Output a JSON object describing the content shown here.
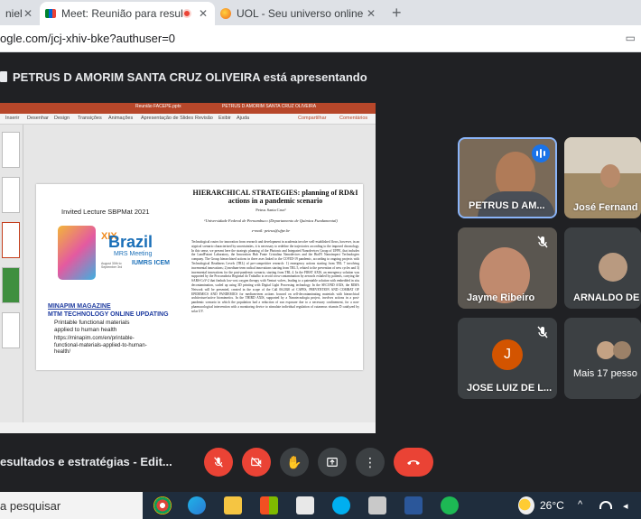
{
  "tabs": [
    {
      "title": "niel",
      "active": false
    },
    {
      "title": "Meet: Reunião para resultad",
      "active": true
    },
    {
      "title": "UOL - Seu universo online",
      "active": false
    }
  ],
  "address": {
    "url": "ogle.com/jcj-xhiv-bke?authuser=0"
  },
  "meet": {
    "presenter_banner": "PETRUS D AMORIM SANTA CRUZ OLIVEIRA está apresentando",
    "meeting_title": "esultados e estratégias - Edit...",
    "participants": [
      {
        "name": "PETRUS D AM...",
        "speaking": true
      },
      {
        "name": "José Fernand"
      },
      {
        "name": "Jayme Ribeiro",
        "muted": true
      },
      {
        "name": "ARNALDO DE"
      },
      {
        "name": "JOSE LUIZ DE L...",
        "initial": "J",
        "muted": true
      },
      {
        "name": "Mais 17 pesso"
      }
    ]
  },
  "ppt": {
    "file_name": "Reunião FACEPE.pptx",
    "file_name_right": "PETRUS D AMORIM SANTA CRUZ OLIVEIRA",
    "ribbon": [
      "Inserir",
      "Desenhar",
      "Design",
      "Transições",
      "Animações",
      "Apresentação de Slides",
      "Revisão",
      "Exibir",
      "Ajuda"
    ],
    "ribbon_right": [
      "Compartilhar",
      "Comentários"
    ]
  },
  "slide": {
    "invited": "Invited Lecture SBPMat 2021",
    "xix": "XIX",
    "brazil": "Brazil",
    "mrs": "MRS Meeting",
    "mrs_date": "August 30th to September 3rd",
    "iumrs": "IUMRS ICEM",
    "magazine_1": "MINAPIM MAGAZINE",
    "magazine_2": "MTM TECHNOLOGY ONLINE UPDATING",
    "printable": "Printable functional materials applied to human health",
    "link": "https://minapim.com/en/printable-functional-materials-applied-to-human-health/",
    "paper_title": "HIERARCHICAL STRATEGIES: planning of RD&I actions in a pandemic scenario",
    "author": "Petrus Santa Cruz¹",
    "affiliation": "¹Universidade Federal de Pernambuco (Departamento de Química Fundamental)",
    "email": "e-mail: petrus@ufpe.br",
    "abstract": "Technological routes for innovation from research and development in academia involve well-established flows, however, in an atypical scenario characterized by uncertainties, it is necessary to redefine the trajectories according to the imposed chronology. In this sense, we present here the strategic planning of the Photonic and Integrated Nanodevices Group of UFPE, that includes the LandFotoni Laboratory, the Innovation Hub Fonte Cristalina Nanodevices and the BioIN Nanoinspect Technologies company. The Group hierarchized actions in three axes linked to the COVID-19 pandemic, according to ongoing projects with Technological Readiness Levels (TRL) of pre-competitive research: 1) emergency actions starting from TRL 7 involving incremental innovations; 2) medium-term radical innovations starting from TRL 5, related to the prevention of new cycles and 3) incremental innovations for the post-pandemic scenario, starting from TRL 4. In the FIRST AXIS, an emergency solution was supported by the Procuradoria Regional do Trabalho to avoid cross-contamination by aerosols exhaled by patients, carrying the SARS-CoV-2 that fimbals low-cost oxygen therapy with Venturi valves, leading to a patentable solution with embedded in situ decontamination, scaled up using 3D printing with Digital Light Processing technology. In the SECOND AXIS, the RIMA Network will be presented, created in the scope of the Call 06/2020 of CAPES, PREVENTION AND COMBAT OF EPIDEMICS AND PANDEMICS for medium-term actions focused on self-decontaminating materials with hierarchical architecture/active biomimetics. In the THIRD AXIS, supported by a Nanotecnologia project, involves actions in a post-pandemic scenario in which the population had a reduction of sun exposure due to a necessary confinement, for a non-pharmacological intervention with a monitoring device to stimulate individual regulation of cutaneous vitamin D catalyzed by solar UV."
  },
  "taskbar": {
    "search": "a pesquisar",
    "temperature": "26°C"
  },
  "colors": {
    "meet_bg": "#202124",
    "end_call": "#ea4335",
    "ppt_brand": "#b7472a",
    "active_tile": "#8ab4f8"
  }
}
